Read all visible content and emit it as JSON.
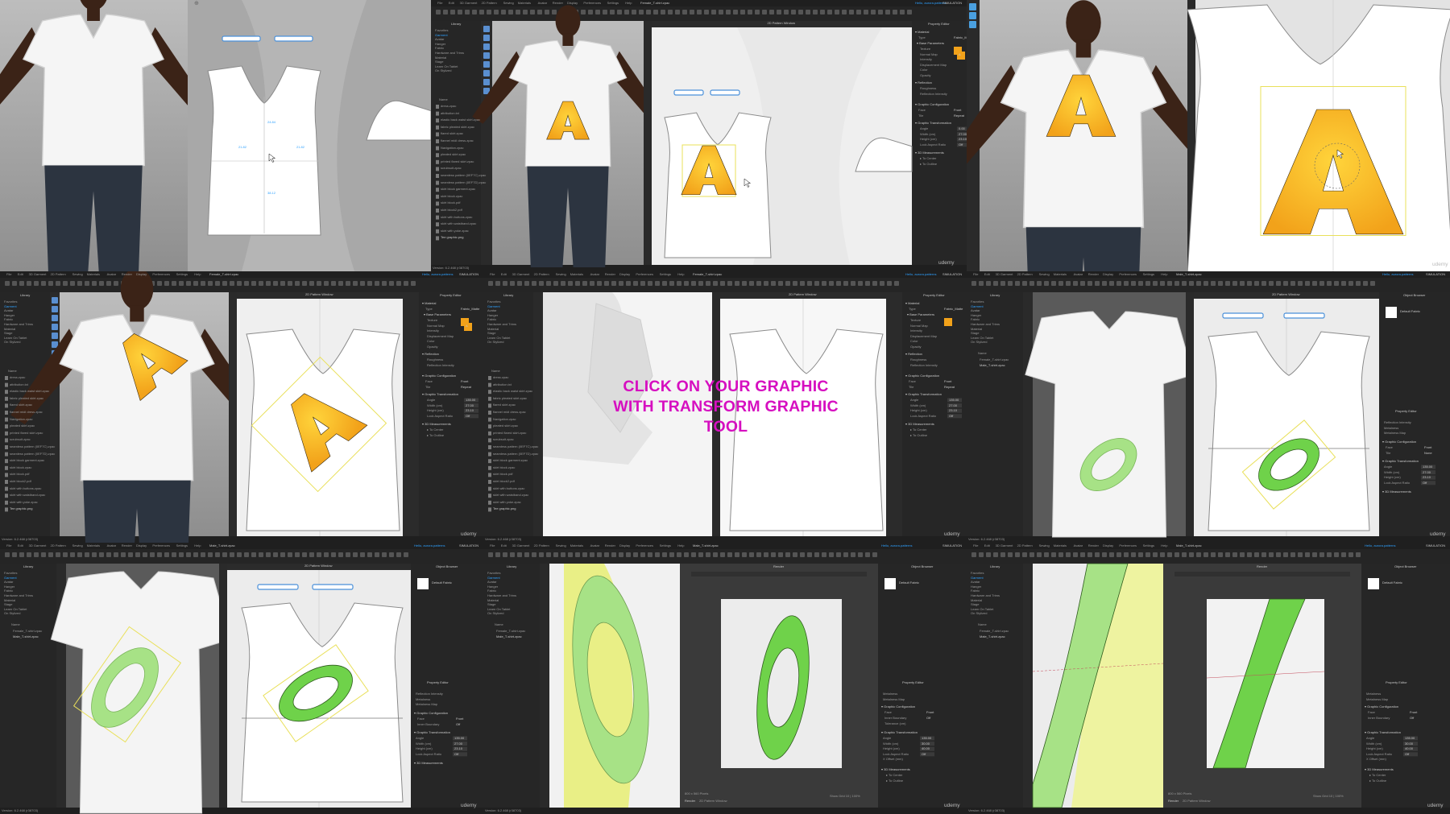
{
  "overlay_caption": "CLICK ON YOUR GRAPHIC WITH TRANSFORM GRAPHIC TOOL",
  "graphic_letter": "A",
  "watermark": "udemy",
  "menu_bar": [
    "File",
    "Edit",
    "3D Garment",
    "2D Pattern",
    "Sewing",
    "Materials",
    "Avatar",
    "Render",
    "Display",
    "Preferences",
    "Settings",
    "Help"
  ],
  "user_badge": "Hello, aurora.patterns",
  "mode_label": "SIMULATION",
  "window_titles": {
    "library": "Library",
    "pattern_2d": "2D Pattern Window",
    "property_editor": "Property Editor",
    "object_browser": "Object Browser",
    "render": "Render"
  },
  "file_names": {
    "female": "Female_T-shirt.zpac",
    "male": "Male_T-shirt.zpac"
  },
  "library_tree": [
    "Favorites",
    "Garment",
    "Avatar",
    "Hanger",
    "Fabric",
    "Hardware and Trims",
    "Material",
    "Stage",
    "Learn On Tablet",
    "On Stylized"
  ],
  "file_list_header": "Name",
  "file_list": [
    "dress.zpac",
    "attribution.txt",
    "elastic back waist skirt.zpac",
    "fabric pleated skirt.zpac",
    "flared skirt.zpac",
    "flannel midi dress.zpac",
    "Navigation.zpac",
    "pleated skirt.zpac",
    "printed flared skirt.zpac",
    "scrubsuit.zpac",
    "seamless pattern (0EF7C).zpac",
    "seamless pattern (0EF7D).zpac",
    "skirt block garment.zpac",
    "skirt block.zpac",
    "skirt block.pdf",
    "skirt block2.pdf",
    "skirt with buttons.zpac",
    "skirt with waistband.zpac",
    "skirt with yoke.zpac",
    "Tee graphic.png"
  ],
  "object_list": [
    "Female_T-shirt.zpac",
    "Male_T-shirt.zpac"
  ],
  "fabric_item": "Default Fabric",
  "dimension_labels": {
    "width_left": "21.82",
    "width_right": "21.82",
    "neck_depth": "24.84",
    "length": "38.12"
  },
  "property_panel": {
    "top_fields": [
      "Name",
      "Item No.",
      "Classification",
      "Notes"
    ],
    "material_section": "Material",
    "type_label": "Type",
    "type_value": "Fabric_Matte",
    "base_params": "Base Parameters",
    "rows": [
      "Texture",
      "Normal Map",
      "Intensity",
      "Displacement Map",
      "Color",
      "Opacity",
      "Reflection",
      "Roughness",
      "Reflection Intensity"
    ],
    "graphic_config": "Graphic Configuration",
    "face_label": "Face",
    "face_value": "Front",
    "tile_label": "Tile",
    "tile_value": "Repeat",
    "none_value": "None",
    "graphic_transform": "Graphic Transformation",
    "transform_rows": [
      "Angle",
      "Width (cm)",
      "Height (cm)",
      "Lock Aspect Ratio",
      "X Offset (mm)"
    ],
    "transform_values_a": [
      "0.00",
      "27.00",
      "23.10",
      "Off"
    ],
    "transform_values_b": [
      "135.00",
      "27.00",
      "23.10",
      "Off"
    ],
    "transform_values_c": [
      "135.00",
      "30.00",
      "40.00",
      "Off"
    ],
    "measure_section": "3D Measurements",
    "measure_rows": [
      "To Center",
      "To Outline"
    ],
    "inner_boundary": "Inner Boundary",
    "off": "Off",
    "tolerance": "Tolerance (cm)",
    "metalness": "Metalness",
    "metalness_map": "Metalness Map"
  },
  "status_bar": {
    "version": "Version: 6.2.468 (r38703)",
    "render_size": "800 x 560 Pixels",
    "render_tabs": [
      "Render",
      "2D Pattern Window"
    ],
    "show_grid": "Show Grid  10  |  100%"
  },
  "colors": {
    "ui_dark": "#2b2b2b",
    "canvas_grey": "#9d9d9d",
    "pattern_white": "#ffffff",
    "selection_yellow": "#e9e05a",
    "letter_orange": "#f2a21a",
    "letter_yellow": "#ffd43b",
    "green_bright": "#6fd24a",
    "green_light": "#a7e286",
    "caption_magenta": "#d60fc0",
    "accent_blue": "#2ea1ff"
  }
}
